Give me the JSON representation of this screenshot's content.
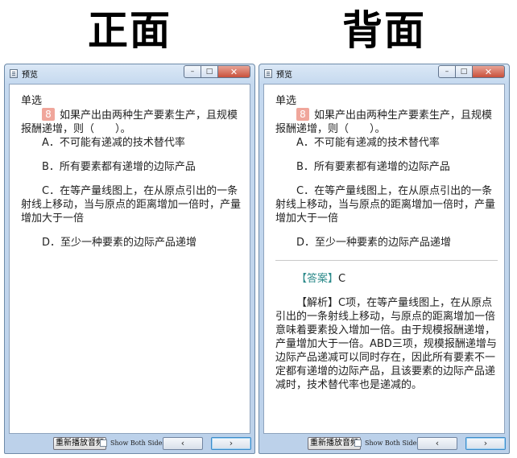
{
  "labels": {
    "front": "正面",
    "back": "背面"
  },
  "window": {
    "title": "预览",
    "controls": {
      "minimize": "–",
      "maximize": "□",
      "close": "✕"
    }
  },
  "question": {
    "type": "单选",
    "number": "8",
    "stem": "如果产出由两种生产要素生产，且规模报酬递增，则（　　）。",
    "options": [
      "A．不可能有递减的技术替代率",
      "B．所有要素都有递增的边际产品",
      "C．在等产量线图上，在从原点引出的一条射线上移动，当与原点的距离增加一倍时，产量增加大于一倍",
      "D．至少一种要素的边际产品递增"
    ]
  },
  "answer": {
    "label": "【答案】",
    "value": "C",
    "explanation_label": "【解析】",
    "explanation": "C项，在等产量线图上，在从原点引出的一条射线上移动，与原点的距离增加一倍意味着要素投入增加一倍。由于规模报酬递增，产量增加大于一倍。ABD三项，规模报酬递增与边际产品递减可以同时存在，因此所有要素不一定都有递增的边际产品，且该要素的边际产品递减时，技术替代率也是递减的。"
  },
  "footer": {
    "replay_button": "重新播放音频",
    "show_both_sides": "Show Both Sides",
    "show_both_sides_checked": false,
    "prev_label": "‹",
    "next_label": "›"
  },
  "colors": {
    "number_badge": "#f0a69b",
    "answer_label": "#2e8b8b",
    "close_button": "#c9503b"
  }
}
